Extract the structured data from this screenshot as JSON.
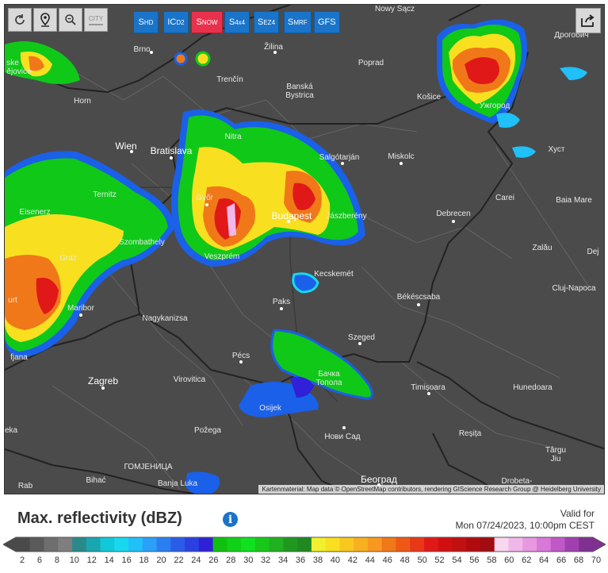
{
  "controls": {
    "refresh_icon": "refresh-icon",
    "locate_icon": "location-pin-icon",
    "zoom_icon": "zoom-out-icon",
    "city_label": "CITY"
  },
  "models": [
    {
      "main": "S",
      "sub": "HD",
      "active": false
    },
    {
      "main": "IC",
      "sub": "D2",
      "active": false
    },
    {
      "main": "S",
      "sub": "NOW",
      "active": true
    },
    {
      "main": "S",
      "sub": "4x4",
      "active": false
    },
    {
      "main": "S",
      "sub": "EZ4",
      "active": false
    },
    {
      "main": "S",
      "sub": "MRF",
      "active": false
    },
    {
      "main": "GFS",
      "sub": "",
      "active": false
    }
  ],
  "cities": [
    {
      "name": "Nowy Sącz",
      "big": false
    },
    {
      "name": "Дрогобич",
      "big": false
    },
    {
      "name": "Brno",
      "big": false
    },
    {
      "name": "Žilina",
      "big": false
    },
    {
      "name": "Poprad",
      "big": false
    },
    {
      "name": "Trenčín",
      "big": false
    },
    {
      "name": "Banská Bystrica",
      "big": false
    },
    {
      "name": "Košice",
      "big": false
    },
    {
      "name": "Ужгород",
      "big": false
    },
    {
      "name": "Horn",
      "big": false
    },
    {
      "name": "Nitra",
      "big": false
    },
    {
      "name": "Wien",
      "big": true
    },
    {
      "name": "Bratislava",
      "big": true
    },
    {
      "name": "Salgótarján",
      "big": false
    },
    {
      "name": "Miskolc",
      "big": false
    },
    {
      "name": "Хуст",
      "big": false
    },
    {
      "name": "Ternitz",
      "big": false
    },
    {
      "name": "Győr",
      "big": false
    },
    {
      "name": "Carei",
      "big": false
    },
    {
      "name": "Baia Mare",
      "big": false
    },
    {
      "name": "Eisenerz",
      "big": false
    },
    {
      "name": "Budapest",
      "big": true
    },
    {
      "name": "Jászberény",
      "big": false
    },
    {
      "name": "Debrecen",
      "big": false
    },
    {
      "name": "Szombathely",
      "big": false
    },
    {
      "name": "Zalău",
      "big": false
    },
    {
      "name": "Graz",
      "big": false
    },
    {
      "name": "Veszprém",
      "big": false
    },
    {
      "name": "Dej",
      "big": false
    },
    {
      "name": "Kecskemét",
      "big": false
    },
    {
      "name": "Cluj-Napoca",
      "big": false
    },
    {
      "name": "Paks",
      "big": false
    },
    {
      "name": "Békéscsaba",
      "big": false
    },
    {
      "name": "Maribor",
      "big": false
    },
    {
      "name": "Nagykanizsa",
      "big": false
    },
    {
      "name": "Szeged",
      "big": false
    },
    {
      "name": "Pécs",
      "big": false
    },
    {
      "name": "Zagreb",
      "big": true
    },
    {
      "name": "Virovitica",
      "big": false
    },
    {
      "name": "Бачка Топола",
      "big": false
    },
    {
      "name": "Timișoara",
      "big": false
    },
    {
      "name": "Hunedoara",
      "big": false
    },
    {
      "name": "Osijek",
      "big": false
    },
    {
      "name": "Požega",
      "big": false
    },
    {
      "name": "Нови Сад",
      "big": false
    },
    {
      "name": "Reșița",
      "big": false
    },
    {
      "name": "Târgu Jiu",
      "big": false
    },
    {
      "name": "ГОМЈЕНИЦА",
      "big": false
    },
    {
      "name": "Bihać",
      "big": false
    },
    {
      "name": "Banja Luka",
      "big": false
    },
    {
      "name": "Београд",
      "big": true
    },
    {
      "name": "Drobeta-",
      "big": false
    },
    {
      "name": "Rab",
      "big": false
    },
    {
      "name": "fjana",
      "big": false
    },
    {
      "name": "urt",
      "big": false
    },
    {
      "name": "eka",
      "big": false
    },
    {
      "name": "ske",
      "big": false
    },
    {
      "name": "ějovice",
      "big": false
    }
  ],
  "attribution": "Kartenmaterial: Map data © OpenStreetMap contributors, rendering GIScience Research Group @ Heidelberg University",
  "legend": {
    "title": "Max. reflectivity (dBZ)",
    "valid_label": "Valid for",
    "valid_time": "Mon 07/24/2023, 10:00pm CEST",
    "ticks": [
      "2",
      "6",
      "8",
      "10",
      "12",
      "14",
      "16",
      "18",
      "20",
      "22",
      "24",
      "26",
      "28",
      "30",
      "32",
      "34",
      "36",
      "38",
      "40",
      "42",
      "44",
      "46",
      "48",
      "50",
      "52",
      "54",
      "56",
      "58",
      "60",
      "62",
      "64",
      "66",
      "68",
      "70"
    ],
    "colors": [
      "#4a4a4a",
      "#5a5a5a",
      "#6e6e6e",
      "#7e7e7e",
      "#2a8a8a",
      "#1aa6b0",
      "#10c8d8",
      "#18d8f0",
      "#20c0f8",
      "#2aa0f8",
      "#2a7ef0",
      "#2a5ce8",
      "#2a40e0",
      "#3020d8",
      "#10c010",
      "#10d018",
      "#10e020",
      "#18c818",
      "#20b020",
      "#209820",
      "#208820",
      "#f0f030",
      "#f8e020",
      "#f8c820",
      "#f8b020",
      "#f89820",
      "#f07818",
      "#f05818",
      "#e83818",
      "#e01818",
      "#d01010",
      "#c01010",
      "#b00c10",
      "#a00c10",
      "#f8d8f0",
      "#f0b8e8",
      "#e898e0",
      "#d878d8",
      "#c058c8",
      "#a040b0",
      "#803090"
    ]
  }
}
